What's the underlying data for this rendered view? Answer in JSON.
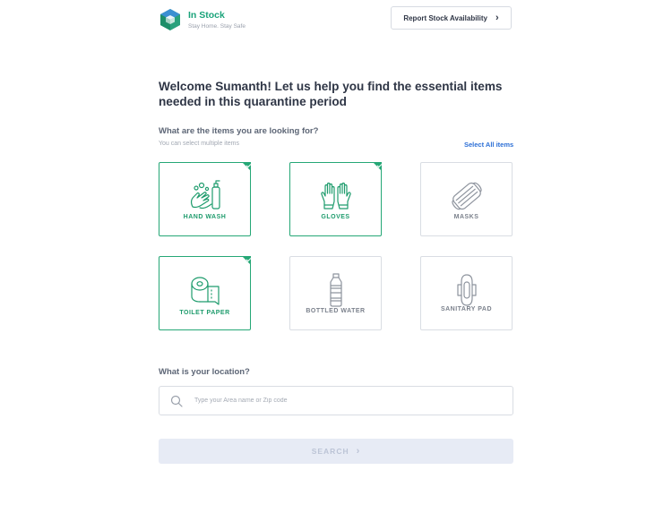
{
  "brand": {
    "name": "In Stock",
    "tagline": "Stay Home. Stay Safe"
  },
  "header": {
    "report_label": "Report Stock Availability"
  },
  "main": {
    "welcome": "Welcome Sumanth!  Let us help you find the essential items needed in this quarantine period",
    "items_question": "What are the items you are looking for?",
    "items_hint": "You can select multiple items",
    "select_all": "Select All items",
    "items": [
      {
        "label": "HAND WASH",
        "icon": "hand-wash-icon",
        "selected": true
      },
      {
        "label": "GLOVES",
        "icon": "gloves-icon",
        "selected": true
      },
      {
        "label": "MASKS",
        "icon": "mask-icon",
        "selected": false
      },
      {
        "label": "TOILET PAPER",
        "icon": "toilet-paper-icon",
        "selected": true
      },
      {
        "label": "BOTTLED WATER",
        "icon": "water-bottle-icon",
        "selected": false
      },
      {
        "label": "SANITARY PAD",
        "icon": "sanitary-pad-icon",
        "selected": false
      }
    ],
    "location_question": "What is your location?",
    "location_placeholder": "Type your Area name or Zip code",
    "location_value": "",
    "search_label": "SEARCH"
  },
  "colors": {
    "accent": "#25a776",
    "link": "#2c6fd6",
    "text": "#2f3646",
    "disabled_button": "#e7ebf5"
  }
}
